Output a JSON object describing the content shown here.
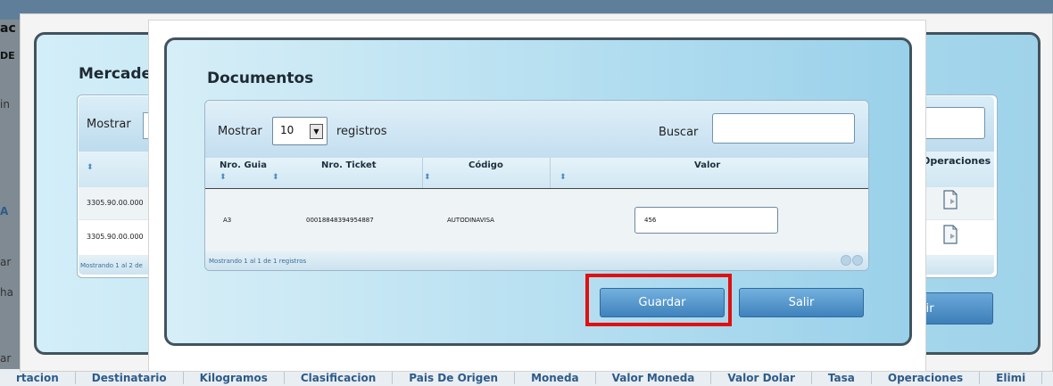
{
  "background": {
    "left_fragments": [
      "ac",
      "DE",
      "in",
      "A",
      "ar",
      "ha",
      "ar"
    ],
    "bottom_columns": [
      "rtacion",
      "Destinatario",
      "Kilogramos",
      "Clasificacion",
      "Pais De Origen",
      "Moneda",
      "Valor Moneda",
      "Valor Dolar",
      "Tasa",
      "Operaciones",
      "Elimi"
    ]
  },
  "outer_panel": {
    "title": "Mercader",
    "mostrar_label": "Mostrar",
    "operaciones_header": "Operaciones",
    "rows": [
      "3305.90.00.000",
      "3305.90.00.000"
    ],
    "footer_text": "Mostrando 1 al 2 de",
    "salir_label": "alir"
  },
  "dialog": {
    "title": "Documentos",
    "mostrar_label": "Mostrar",
    "length_value": "10",
    "registros_label": "registros",
    "buscar_label": "Buscar",
    "columns": [
      "Nro. Guia",
      "Nro. Ticket",
      "Código",
      "Valor"
    ],
    "row": {
      "nro_guia": "A3",
      "nro_ticket": "00018848394954887",
      "codigo": "AUTODINAVISA",
      "valor": "456"
    },
    "footer_text": "Mostrando 1 al 1 de 1 registros",
    "guardar_label": "Guardar",
    "salir_label": "Salir"
  },
  "colors": {
    "highlight": "#e01010",
    "button": "#4a8cc4",
    "panel_border": "#41535e"
  }
}
